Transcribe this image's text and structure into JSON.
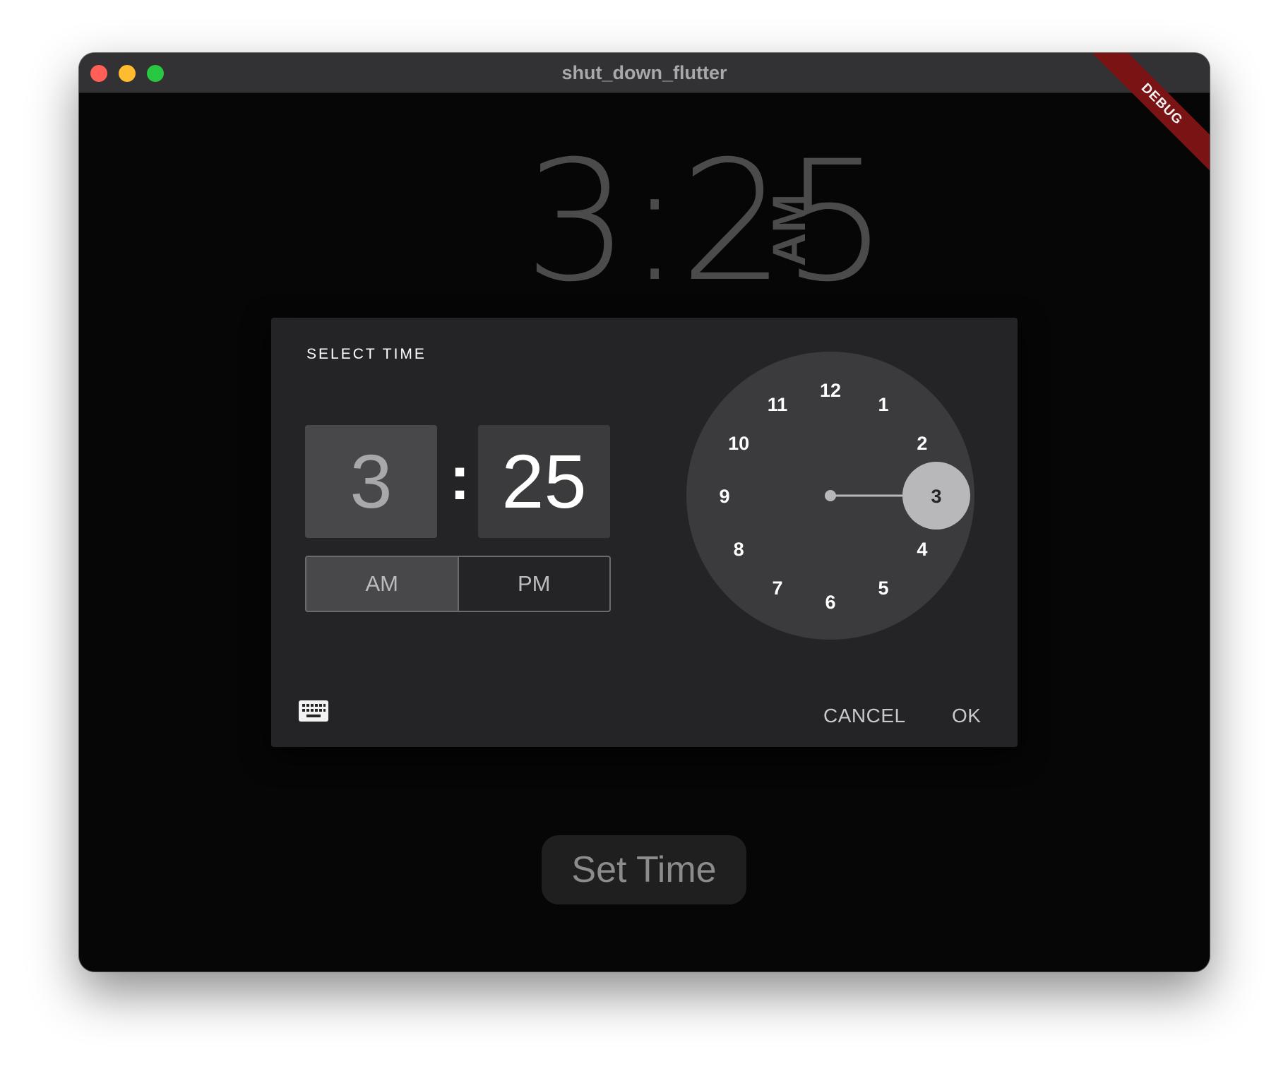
{
  "window": {
    "title": "shut_down_flutter",
    "debug_banner": "DEBUG"
  },
  "clock_display": {
    "time": "3:25",
    "period": "AM"
  },
  "dialog": {
    "title": "SELECT TIME",
    "hour": "3",
    "separator": ":",
    "minute": "25",
    "am_label": "AM",
    "pm_label": "PM",
    "selected_period": "AM",
    "dial_numbers": [
      "12",
      "1",
      "2",
      "3",
      "4",
      "5",
      "6",
      "7",
      "8",
      "9",
      "10",
      "11"
    ],
    "selected_hour": "3",
    "cancel_label": "CANCEL",
    "ok_label": "OK",
    "mode_icon": "keyboard-icon"
  },
  "set_time_button": {
    "label": "Set Time"
  },
  "colors": {
    "background": "#060606",
    "dialog": "#242426",
    "dial": "#3b3b3e",
    "selected_hour_bubble": "#b8b8ba",
    "close": "#ff5f57",
    "minimize": "#febc2e",
    "zoom": "#28c840",
    "debug": "#7a1313"
  }
}
